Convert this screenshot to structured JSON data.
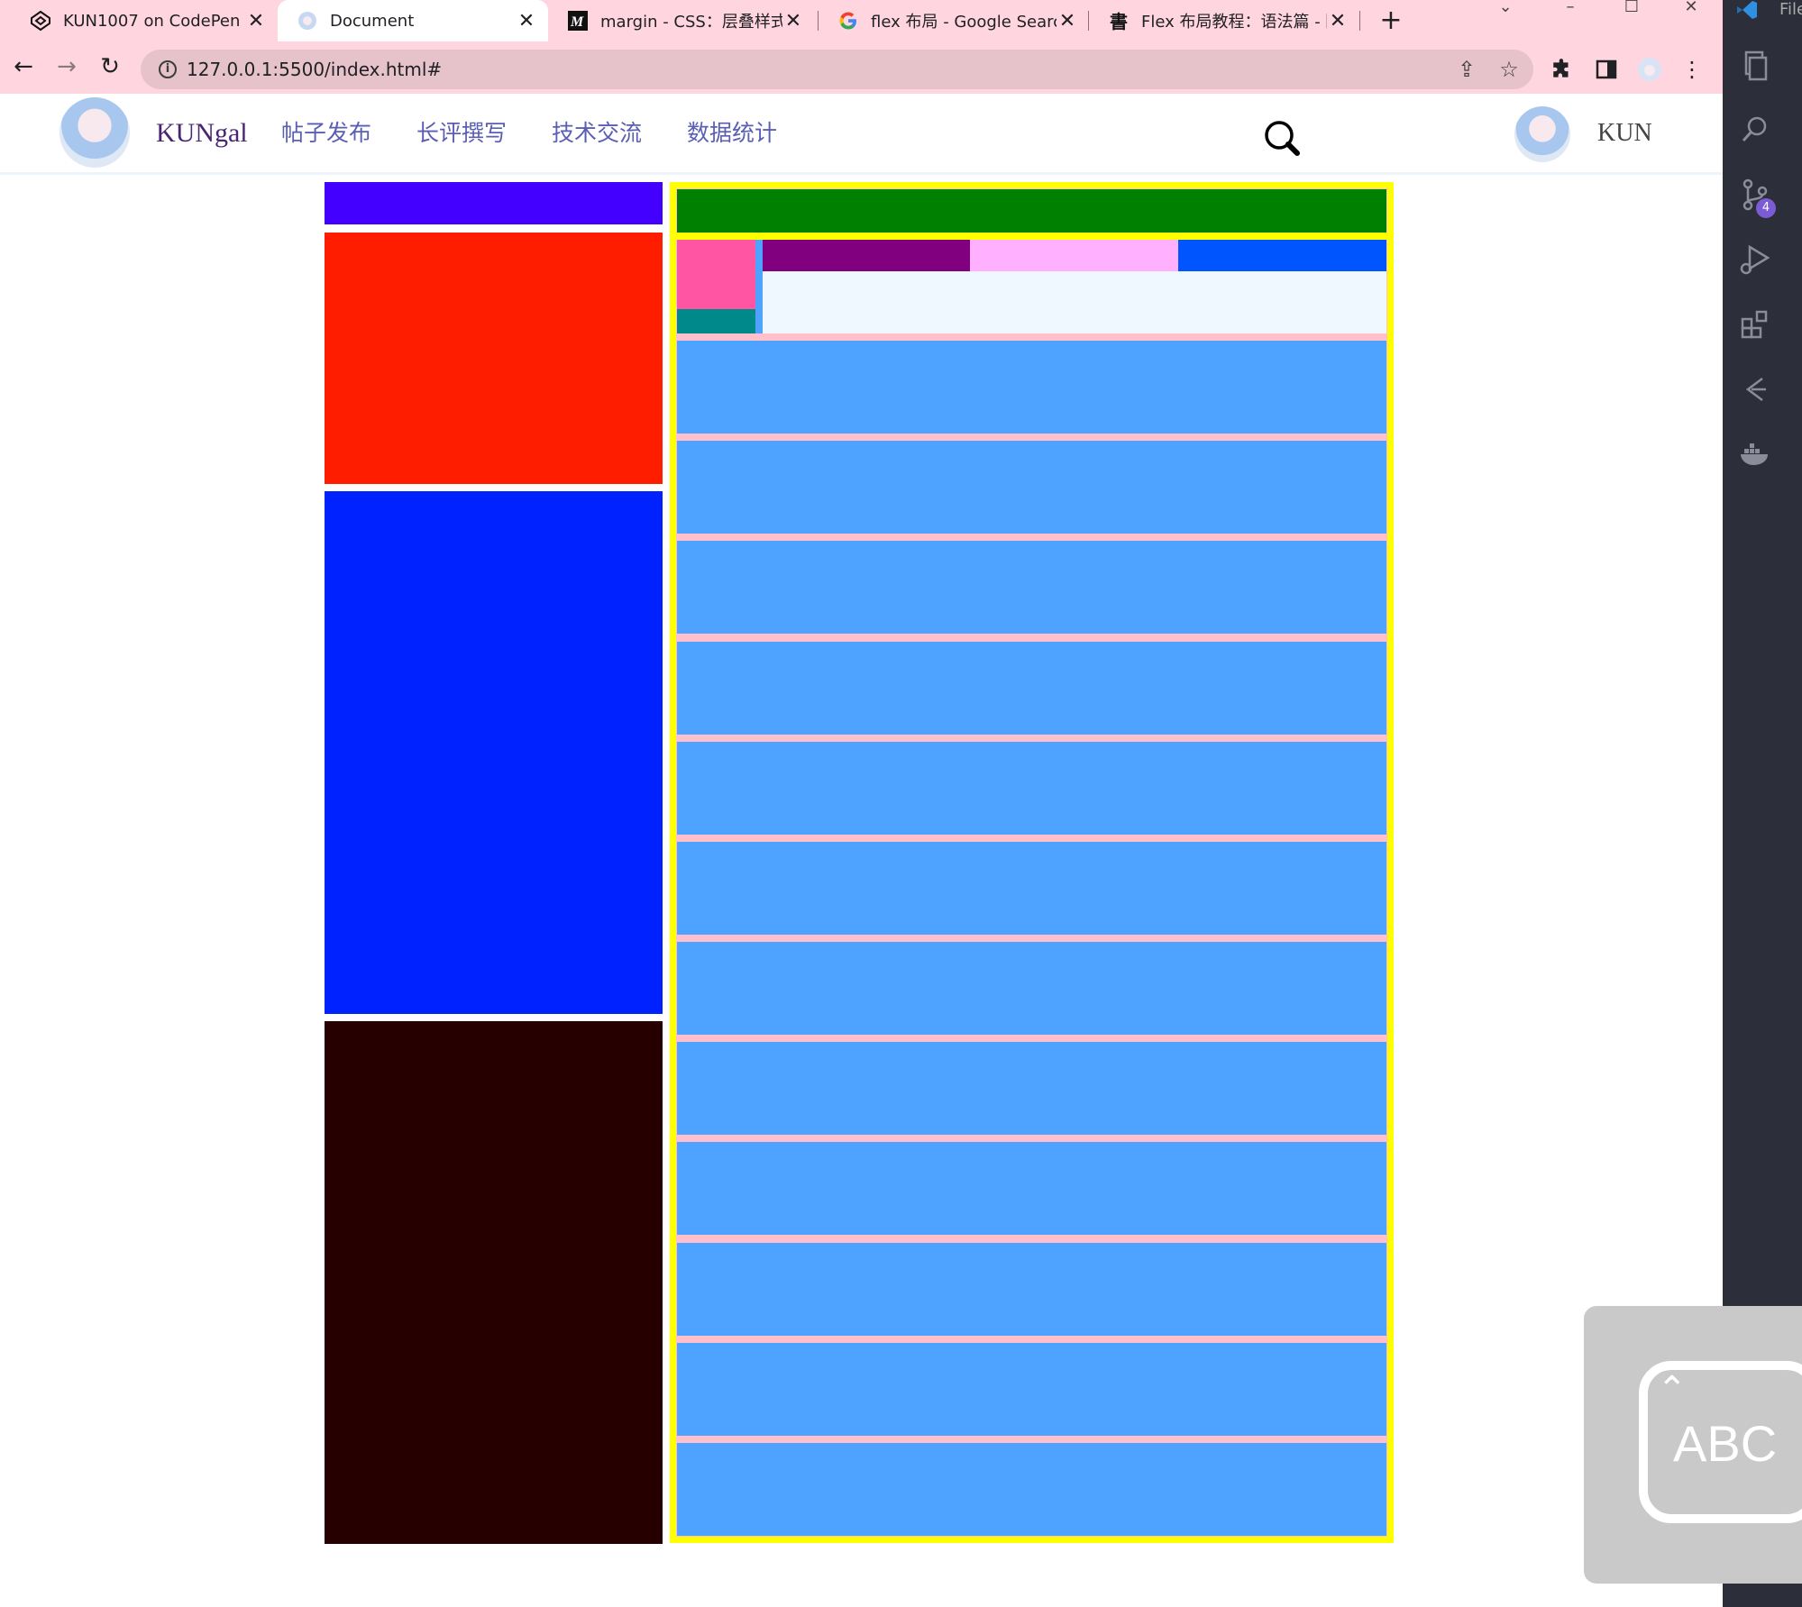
{
  "browser": {
    "tabs": [
      {
        "title": "KUN1007 on CodePen",
        "favicon": "codepen-icon",
        "active": false
      },
      {
        "title": "Document",
        "favicon": "anime-avatar-icon",
        "active": true
      },
      {
        "title": "margin - CSS：层叠样式表",
        "favicon": "mdn-icon",
        "active": false
      },
      {
        "title": "flex 布局 - Google Search",
        "favicon": "google-icon",
        "active": false
      },
      {
        "title": "Flex 布局教程：语法篇 - 阮",
        "favicon": "ruanyf-icon",
        "active": false
      }
    ],
    "url": "127.0.0.1:5500/index.html#",
    "tab_strip_color": "#ffd5df"
  },
  "site": {
    "logo_text": "KUNgal",
    "nav": [
      "帖子发布",
      "长评撰写",
      "技术交流",
      "数据统计"
    ],
    "user_name": "KUN"
  },
  "layout_colors": {
    "left_top_bar": "#4400ff",
    "left_red": "#ff1d00",
    "left_blue": "#0022ff",
    "left_dark": "#260000",
    "main_border": "#ffff00",
    "main_header": "#008000",
    "pink_square": "#ff55a3",
    "teal_strip": "#00898a",
    "purple_tab": "#800080",
    "light_pink_tab": "#ffb0ff",
    "blue_tab": "#0055ff",
    "tab_panel_bg": "#f0f8ff",
    "row_fill": "#4da3ff",
    "row_separator": "#ffc0cb"
  },
  "list_rows": 12,
  "vscode": {
    "label": "File",
    "scm_badge": "4"
  },
  "ime": {
    "label": "ABC"
  }
}
